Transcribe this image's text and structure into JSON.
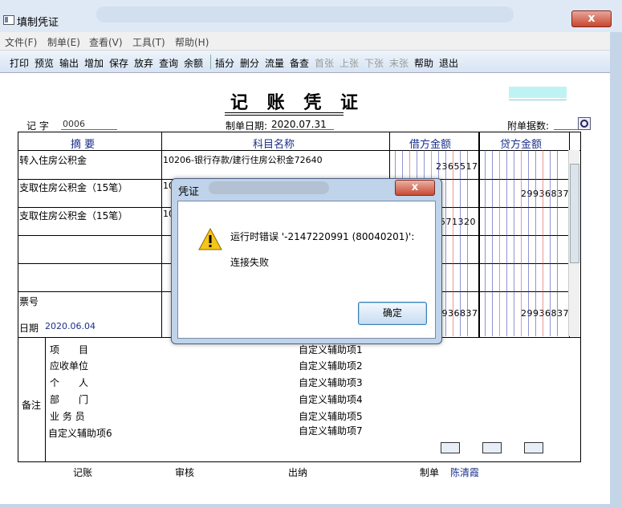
{
  "window": {
    "title": "填制凭证",
    "close": "x"
  },
  "menu": [
    "文件(F)",
    "制单(E)",
    "查看(V)",
    "工具(T)",
    "帮助(H)"
  ],
  "toolbar": {
    "group1": [
      "打印",
      "预览",
      "输出",
      "增加",
      "保存",
      "放弃",
      "查询",
      "余额"
    ],
    "group2": [
      "插分",
      "删分",
      "流量",
      "备查"
    ],
    "group2_disabled": [
      "首张",
      "上张",
      "下张",
      "末张"
    ],
    "group3": [
      "帮助",
      "退出"
    ]
  },
  "voucher": {
    "title": "记 账 凭 证",
    "type_label": "记 字",
    "number": "0006",
    "date_label": "制单日期:",
    "date": "2020.07.31",
    "attachments_label": "附单据数:",
    "headers": {
      "summary": "摘 要",
      "account": "科目名称",
      "debit": "借方金额",
      "credit": "贷方金额"
    },
    "rows": [
      {
        "summary": "转入住房公积金",
        "account": "10206-银行存款/建行住房公积金72640",
        "debit": "2365517",
        "credit": ""
      },
      {
        "summary": "支取住房公积金（15笔）",
        "account": "10",
        "debit": "",
        "credit": "29936837"
      },
      {
        "summary": "支取住房公积金（15笔）",
        "account": "10",
        "debit": "571320",
        "credit": ""
      }
    ],
    "ticket_label": "票号",
    "date_row_label": "日期",
    "date_row_value": "2020.06.04",
    "total_debit": "9936837",
    "total_credit": "29936837",
    "remarks_label": "备注",
    "remarks_left": [
      "项　　目",
      "应收单位",
      "个　　人",
      "部　　门",
      "业 务 员",
      "自定义辅助项6"
    ],
    "remarks_right": [
      "自定义辅助项1",
      "自定义辅助项2",
      "自定义辅助项3",
      "自定义辅助项4",
      "自定义辅助项5",
      "自定义辅助项7"
    ],
    "footer": {
      "post": "记账",
      "review": "审核",
      "cashier": "出纳",
      "maker_label": "制单",
      "maker": "陈清霞"
    }
  },
  "dialog": {
    "title": "凭证",
    "close": "x",
    "message": "运行时错误 '-2147220991 (80040201)':",
    "detail": "连接失败",
    "ok": "确定"
  },
  "colors": {
    "link": "#1a2f8a",
    "accent": "#bfd3ea"
  }
}
